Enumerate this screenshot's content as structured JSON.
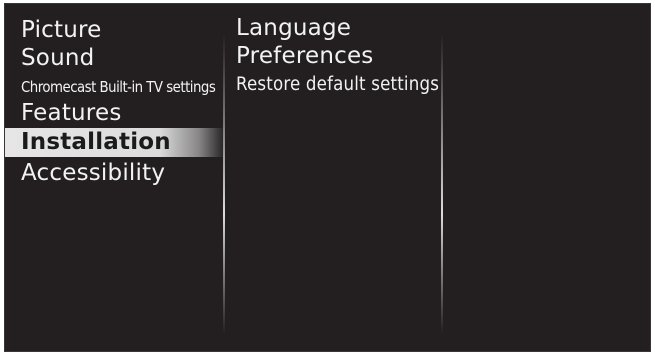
{
  "main_menu": {
    "items": [
      {
        "label": "Picture",
        "selected": false
      },
      {
        "label": "Sound",
        "selected": false
      },
      {
        "label": "Chromecast Built-in TV settings",
        "selected": false
      },
      {
        "label": "Features",
        "selected": false
      },
      {
        "label": "Installation",
        "selected": true
      },
      {
        "label": "Accessibility",
        "selected": false
      }
    ]
  },
  "submenu": {
    "items": [
      {
        "label": "Language"
      },
      {
        "label": "Preferences"
      },
      {
        "label": "Restore default settings"
      }
    ]
  },
  "colors": {
    "background": "#231f20",
    "text": "#f2f2f2",
    "selected_background": "#e6e6e6",
    "selected_text": "#1b1b1b"
  }
}
